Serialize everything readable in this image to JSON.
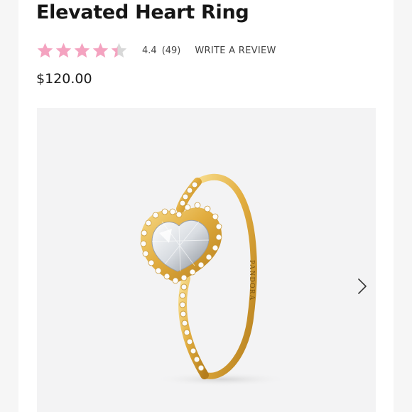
{
  "product": {
    "title": "Elevated Heart Ring",
    "rating": {
      "value": "4.4",
      "count": "(49)",
      "stars_filled": 4.4,
      "stars_total": 5,
      "star_color": "#f4a3c0",
      "empty_star_color": "#d8d8d8"
    },
    "write_review_label": "WRITE A REVIEW",
    "price": "$120.00",
    "image": {
      "engraving": "PANDORA",
      "metal_color": "#e6b84a",
      "background_color": "#f3f3f4"
    },
    "gallery": {
      "next_icon": "chevron-right-icon"
    }
  }
}
